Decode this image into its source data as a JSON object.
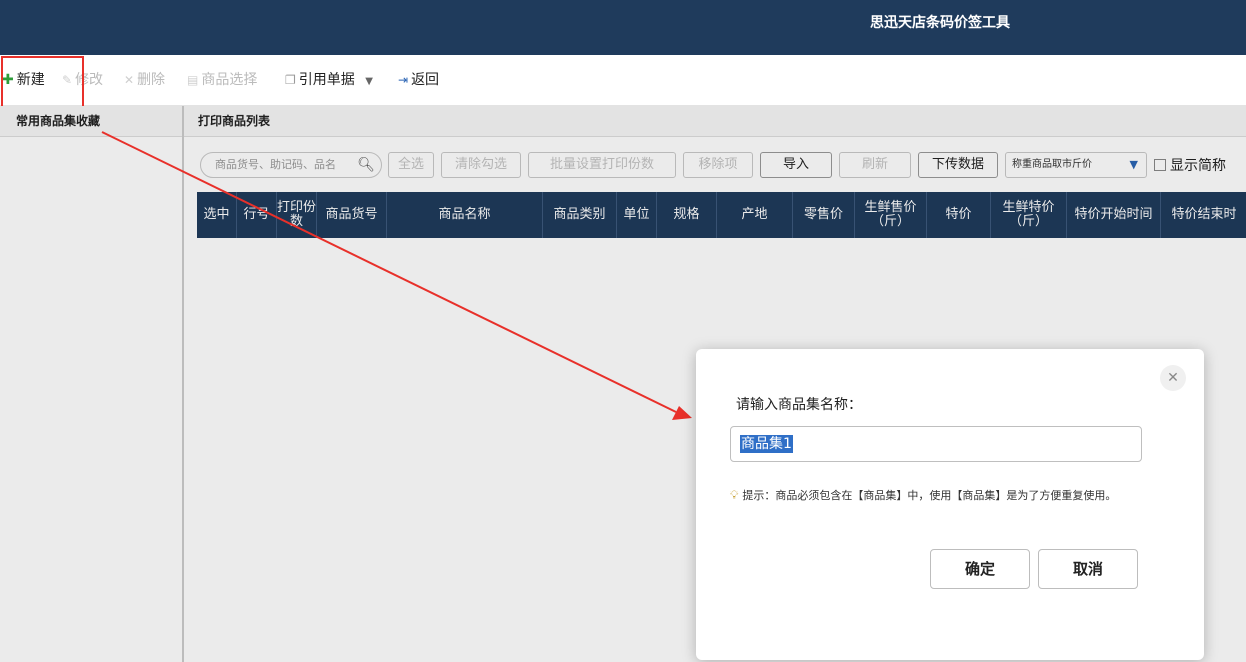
{
  "app": {
    "title": "思迅天店条码价签工具"
  },
  "toolbar": {
    "new": "新建",
    "edit": "修改",
    "delete": "删除",
    "select_goods": "商品选择",
    "ref_doc": "引用单据",
    "back": "返回"
  },
  "left_panel": {
    "title": "常用商品集收藏"
  },
  "right_panel": {
    "title": "打印商品列表",
    "search_placeholder": "商品货号、助记码、品名",
    "buttons": {
      "select_all": "全选",
      "clear_checked": "清除勾选",
      "batch_print_copies": "批量设置打印份数",
      "remove": "移除项",
      "import": "导入",
      "refresh": "刷新",
      "download": "下传数据"
    },
    "weigh_select": "称重商品取市斤价",
    "show_short_name": "显示简称",
    "columns": [
      "选中",
      "行号",
      "打印份数",
      "商品货号",
      "商品名称",
      "商品类别",
      "单位",
      "规格",
      "产地",
      "零售价",
      "生鲜售价（斤）",
      "特价",
      "生鲜特价（斤）",
      "特价开始时间",
      "特价结束时"
    ]
  },
  "dialog": {
    "prompt": "请输入商品集名称：",
    "input_value": "商品集1",
    "tip": "提示：商品必须包含在【商品集】中，使用【商品集】是为了方便重复使用。",
    "ok": "确定",
    "cancel": "取消"
  },
  "colors": {
    "titlebar": "#1f3b5c",
    "highlight": "#e8302a",
    "selection": "#2f6fc7"
  },
  "icons": [
    "plus-icon",
    "pencil-icon",
    "x-icon",
    "document-icon",
    "copy-icon",
    "back-icon",
    "search-icon",
    "close-icon",
    "bulb-icon"
  ]
}
